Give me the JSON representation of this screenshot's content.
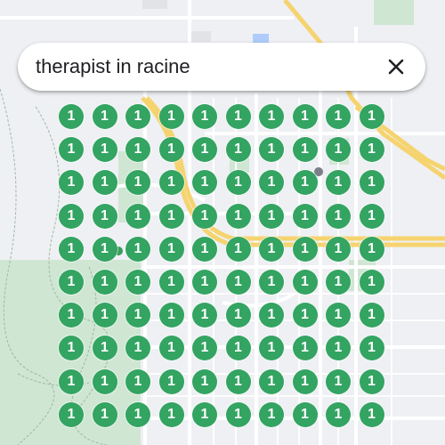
{
  "search": {
    "query": "therapist in racine",
    "close_icon": "close-icon"
  },
  "map": {
    "marker_label": "1",
    "marker_color": "#33a461",
    "park_color": "#cfe6d3",
    "road_major_color": "#f5d36f",
    "road_color": "#ffffff",
    "background_color": "#eef0f3"
  },
  "grid": {
    "rows": 10,
    "cols": 10
  }
}
